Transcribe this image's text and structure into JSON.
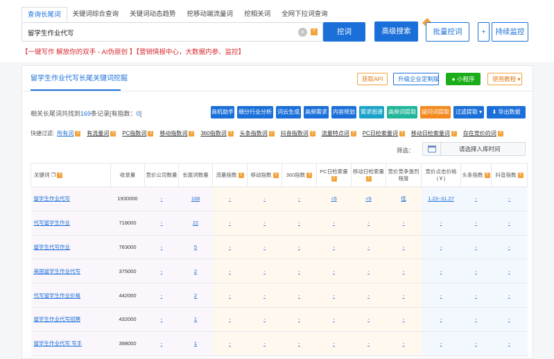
{
  "tabs": [
    "查询长尾词",
    "关键词综合查询",
    "关键词动态趋势",
    "挖移动端流量词",
    "挖相关词",
    "全网下拉词查询"
  ],
  "search": {
    "value": "留学生作业代写",
    "help": "?"
  },
  "buttons": {
    "dig": "挖词",
    "advanced": "高级搜索",
    "batch": "批量挖词",
    "plus": "+",
    "monitor": "持续监控"
  },
  "promo": "【一键写作 解放你的双手 - AI伪原创 】【营销情报中心，大数据内参、监控】",
  "panel": {
    "title": "留学生作业代写长尾关键词挖掘",
    "get_api": "获取API",
    "enterprise": "升级企业定制版",
    "mini_program": "小程序",
    "tutorial": "使用教程 ▾"
  },
  "summary": {
    "prefix": "相关长尾词共找到",
    "count": "169",
    "middle": "条记录[有指数：",
    "index_count": "0",
    "suffix": "]"
  },
  "actions": [
    "商机助手",
    "细分行业分析",
    "词云生成",
    "高频需求",
    "内容规划",
    "需求图谱",
    "高频词提取",
    "疑问词提取",
    "过滤提取 ▾",
    "导出数据"
  ],
  "filters": {
    "label": "快捷过滤:",
    "items": [
      "所有词",
      "有流量词",
      "PC指数词",
      "移动指数词",
      "360指数词",
      "头条指数词",
      "抖音指数词",
      "流量特点词",
      "PC日检索量词",
      "移动日检索量词",
      "存在竞价的词"
    ]
  },
  "screen": {
    "label": "筛选：",
    "placeholder": "请选择入库时间"
  },
  "table": {
    "headers": [
      "关键词",
      "收录量",
      "竞价公司数量",
      "长尾词数量",
      "流量指数",
      "移动指数",
      "360指数",
      "PC日检索量",
      "移动日检索量",
      "竞价竞争激烈程度",
      "竞价点击价格(￥)",
      "头条指数",
      "抖音指数"
    ],
    "rows": [
      [
        "留学生作业代写",
        "1930000",
        "-",
        "168",
        "-",
        "-",
        "-",
        "<5",
        "<5",
        "低",
        "1.23~31.27",
        "-",
        "-"
      ],
      [
        "代写留学生作业",
        "718000",
        "-",
        "22",
        "-",
        "-",
        "-",
        "-",
        "-",
        "-",
        "-",
        "-",
        "-"
      ],
      [
        "留学生代写作业",
        "763000",
        "-",
        "5",
        "-",
        "-",
        "-",
        "-",
        "-",
        "-",
        "-",
        "-",
        "-"
      ],
      [
        "美国留学生作业代写",
        "375000",
        "-",
        "2",
        "-",
        "-",
        "-",
        "-",
        "-",
        "-",
        "-",
        "-",
        "-"
      ],
      [
        "代写留学生作业价格",
        "442000",
        "-",
        "2",
        "-",
        "-",
        "-",
        "-",
        "-",
        "-",
        "-",
        "-",
        "-"
      ],
      [
        "留学生作业代写招聘",
        "432000",
        "-",
        "1",
        "-",
        "-",
        "-",
        "-",
        "-",
        "-",
        "-",
        "-",
        "-"
      ],
      [
        "留学生作业代写 写手",
        "398000",
        "-",
        "1",
        "-",
        "-",
        "-",
        "-",
        "-",
        "-",
        "-",
        "-",
        "-"
      ]
    ]
  },
  "colors": {
    "primary": "#1a6fd8",
    "orange": "#f2a33a",
    "red": "#d9262c",
    "green": "#1aad19"
  }
}
